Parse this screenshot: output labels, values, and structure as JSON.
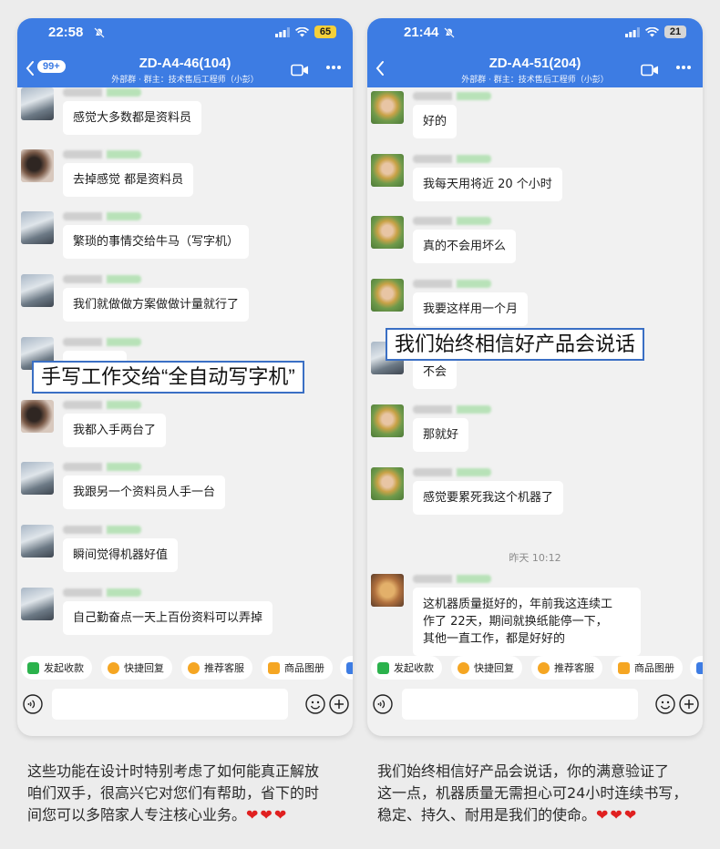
{
  "left_phone": {
    "status": {
      "time": "22:58",
      "battery": "65",
      "battery_color": "#f5d03a"
    },
    "header": {
      "unread_badge": "99+",
      "title": "ZD-A4-46(104)",
      "subtitle": "外部群 · 群主：技术售后工程师（小彭）"
    },
    "messages": [
      {
        "text": "感觉大多数都是资料员"
      },
      {
        "text": "去掉感觉   都是资料员"
      },
      {
        "text": "繁琐的事情交给牛马（写字机）"
      },
      {
        "text": "我们就做做方案做做计量就行了"
      },
      {
        "text": ""
      },
      {
        "text": "我都入手两台了"
      },
      {
        "text": "我跟另一个资料员人手一台"
      },
      {
        "text": "瞬间觉得机器好值"
      },
      {
        "text": "自己勤奋点一天上百份资料可以弄掉"
      }
    ],
    "overlay_caption": "手写工作交给“全自动写字机”",
    "quick_actions": [
      "发起收款",
      "快捷回复",
      "推荐客服",
      "商品图册"
    ],
    "input": {
      "value": "",
      "placeholder": ""
    }
  },
  "right_phone": {
    "status": {
      "time": "21:44",
      "battery": "21",
      "battery_color": "#d6d6d6"
    },
    "header": {
      "title": "ZD-A4-51(204)",
      "subtitle": "外部群 · 群主：技术售后工程师（小彭）"
    },
    "messages": [
      {
        "text": "好的"
      },
      {
        "text": "我每天用将近 20 个小时"
      },
      {
        "text": "真的不会用坏么"
      },
      {
        "text": "我要这样用一个月"
      },
      {
        "text": "不会"
      },
      {
        "text": "那就好"
      },
      {
        "text": "感觉要累死我这个机器了"
      }
    ],
    "timestamp": "昨天 10:12",
    "last_message": "这机器质量挺好的，年前我这连续工\n作了 22天，期间就换纸能停一下，\n其他一直工作，都是好好的",
    "overlay_caption": "我们始终相信好产品会说话",
    "quick_actions": [
      "发起收款",
      "快捷回复",
      "推荐客服",
      "商品图册"
    ],
    "input": {
      "value": "",
      "placeholder": ""
    }
  },
  "captions": {
    "left": "这些功能在设计时特别考虑了如何能真正解放\n咱们双手，很高兴它对您们有帮助，省下的时\n间您可以多陪家人专注核心业务。",
    "right": "我们始终相信好产品会说话，你的满意验证了\n这一点，机器质量无需担心可24小时连续书写，\n稳定、持久、耐用是我们的使命。",
    "hearts": "❤❤❤"
  },
  "colors": {
    "header_blue": "#3d7ce3",
    "chat_bg": "#f1f1f1",
    "highlight_border": "#3a6fc4",
    "heart_red": "#e02020",
    "chip_green": "#2bb24c",
    "chip_orange": "#f5a623"
  },
  "icons": [
    "mute-icon",
    "signal-icon",
    "wifi-icon",
    "back-icon",
    "video-icon",
    "more-icon",
    "voice-icon",
    "emoji-icon",
    "plus-icon"
  ]
}
